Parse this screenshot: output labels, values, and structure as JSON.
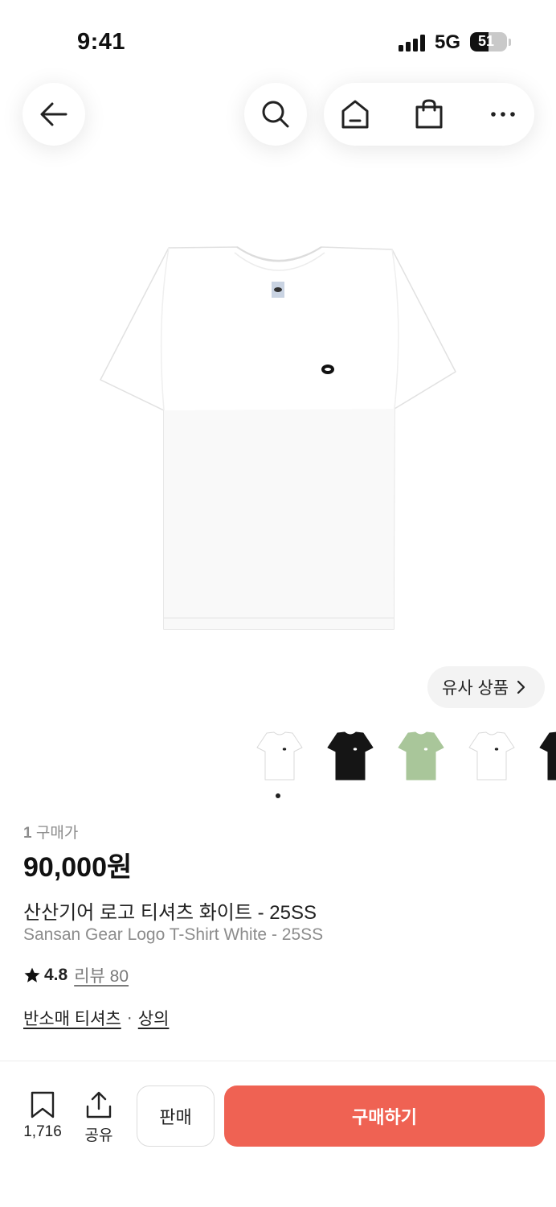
{
  "status_bar": {
    "time": "9:41",
    "network": "5G",
    "battery": "51",
    "battery_level": 0.51
  },
  "nav": {
    "back_icon": "arrow-left-icon",
    "search_icon": "search-icon",
    "home_icon": "home-icon",
    "cart_icon": "shopping-bag-icon",
    "more_icon": "more-horizontal-icon"
  },
  "similar_button": {
    "label": "유사 상품"
  },
  "thumbnails": [
    {
      "color": "#ffffff",
      "name": "white"
    },
    {
      "color": "#151515",
      "name": "black"
    },
    {
      "color": "#a9c69a",
      "name": "green"
    },
    {
      "color": "#ffffff",
      "name": "white"
    },
    {
      "color": "#151515",
      "name": "black"
    }
  ],
  "product": {
    "price_qty": "1",
    "price_label": "구매가",
    "price": "90,000원",
    "name_ko": "산산기어 로고 티셔츠 화이트 - 25SS",
    "name_en": "Sansan Gear Logo T-Shirt White - 25SS",
    "rating": "4.8",
    "reviews_label": "리뷰 80",
    "category_1": "반소매 티셔츠",
    "category_separator": "·",
    "category_2": "상의"
  },
  "bottom_bar": {
    "bookmark_count": "1,716",
    "share_label": "공유",
    "sell_label": "판매",
    "buy_label": "구매하기"
  },
  "colors": {
    "accent": "#ef6253",
    "muted_text": "#8c8c8c"
  }
}
